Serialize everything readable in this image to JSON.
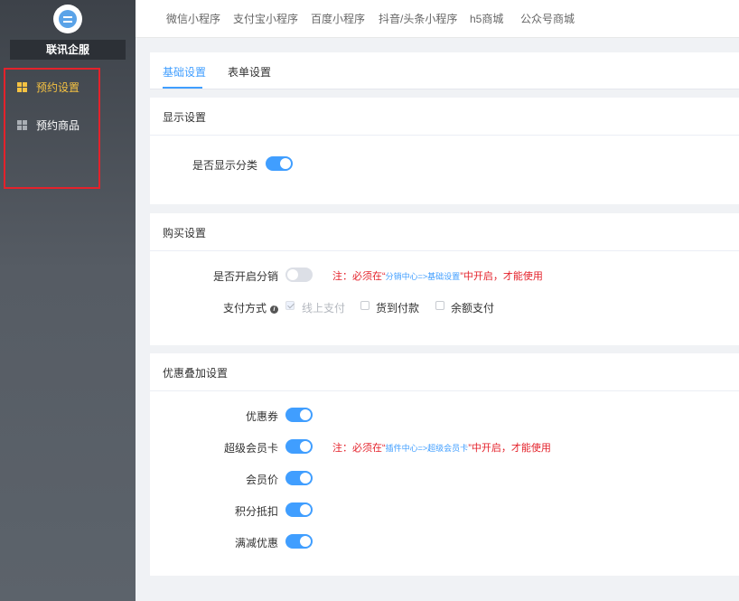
{
  "sidebar": {
    "company_name": "联讯企服",
    "items": [
      {
        "label": "预约设置",
        "active": true
      },
      {
        "label": "预约商品",
        "active": false
      }
    ]
  },
  "topnav": [
    "微信小程序",
    "支付宝小程序",
    "百度小程序",
    "抖音/头条小程序",
    "h5商城",
    "公众号商城"
  ],
  "tabs": [
    {
      "label": "基础设置",
      "active": true
    },
    {
      "label": "表单设置",
      "active": false
    }
  ],
  "display_section": {
    "title": "显示设置",
    "show_category": {
      "label": "是否显示分类",
      "on": true
    }
  },
  "purchase_section": {
    "title": "购买设置",
    "distribution": {
      "label": "是否开启分销",
      "on": false,
      "note_prefix": "注：必须在“",
      "note_link": "分销中心=>基础设置",
      "note_suffix": "”中开启，才能使用"
    },
    "payment": {
      "label": "支付方式",
      "options": [
        {
          "label": "线上支付",
          "checked": true,
          "disabled": true
        },
        {
          "label": "货到付款",
          "checked": false,
          "disabled": false
        },
        {
          "label": "余额支付",
          "checked": false,
          "disabled": false
        }
      ]
    }
  },
  "discount_section": {
    "title": "优惠叠加设置",
    "coupon": {
      "label": "优惠券",
      "on": true
    },
    "super_card": {
      "label": "超级会员卡",
      "on": true,
      "note_prefix": "注：必须在“",
      "note_link": "插件中心=>超级会员卡",
      "note_suffix": "”中开启，才能使用"
    },
    "member_price": {
      "label": "会员价",
      "on": true
    },
    "points": {
      "label": "积分抵扣",
      "on": true
    },
    "full_reduction": {
      "label": "满减优惠",
      "on": true
    }
  },
  "colors": {
    "accent": "#409eff",
    "menu_active": "#f5c242",
    "warning": "#e4222b",
    "highlight_box": "#e4222b"
  }
}
